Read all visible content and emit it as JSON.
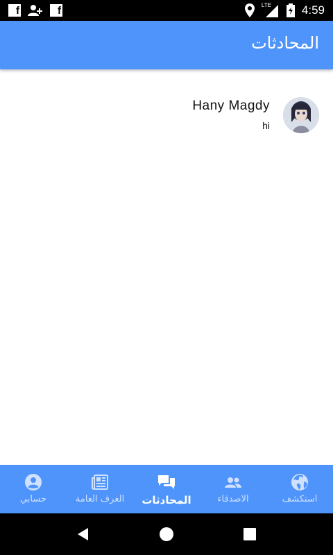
{
  "status_bar": {
    "time": "4:59",
    "network": "LTE",
    "left_icons": [
      "facebook-icon",
      "add-person-icon",
      "facebook-icon"
    ],
    "right_icons": [
      "location-icon",
      "signal-icon",
      "battery-icon"
    ]
  },
  "app_bar": {
    "title": "المحادثات",
    "color": "#4f94fb"
  },
  "conversations": [
    {
      "name": "Hany Magdy",
      "last_message": "hi",
      "avatar": "avatar-icon"
    }
  ],
  "bottom_nav": {
    "items": [
      {
        "label": "حسابي",
        "icon": "account-circle-icon",
        "active": false
      },
      {
        "label": "الغرف العامة",
        "icon": "newspaper-icon",
        "active": false
      },
      {
        "label": "المحادثات",
        "icon": "chat-bubbles-icon",
        "active": true
      },
      {
        "label": "الاصدقاء",
        "icon": "people-icon",
        "active": false
      },
      {
        "label": "استكشف",
        "icon": "globe-icon",
        "active": false
      }
    ]
  },
  "system_nav": [
    "back-icon",
    "home-icon",
    "recents-icon"
  ]
}
